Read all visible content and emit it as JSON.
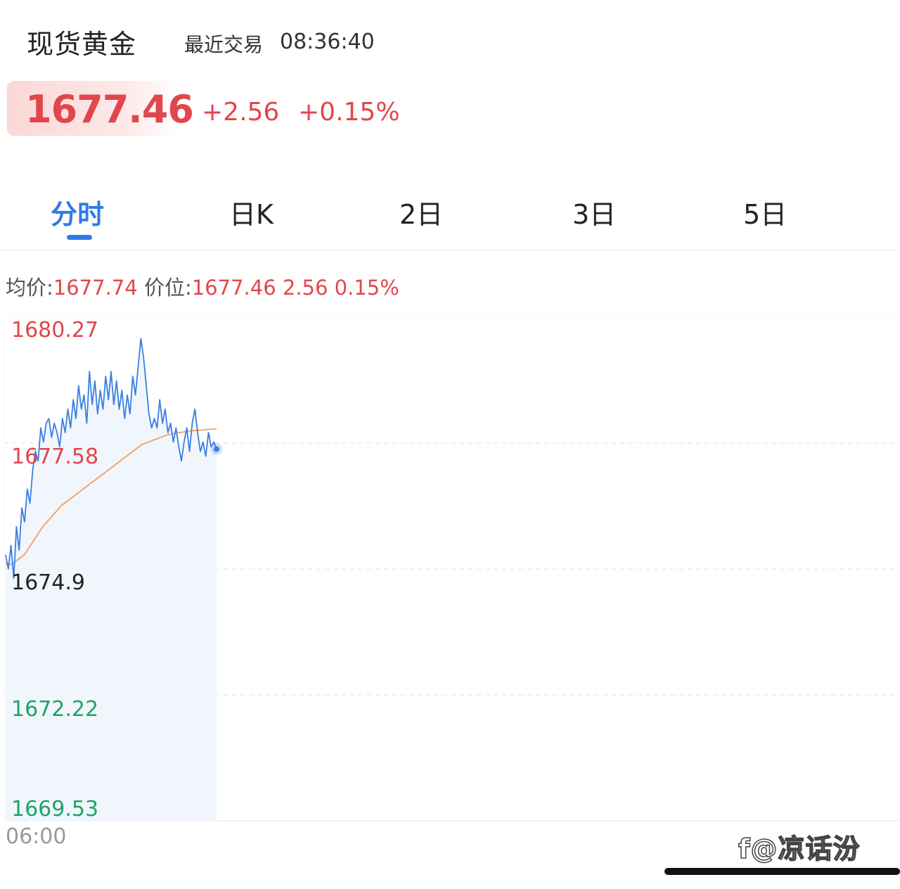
{
  "header": {
    "title": "现货黄金",
    "trade_label": "最近交易",
    "trade_time": "08:36:40"
  },
  "quote": {
    "price": "1677.46",
    "change": "+2.56",
    "change_pct": "+0.15%"
  },
  "tabs": [
    {
      "label": "分时",
      "active": true
    },
    {
      "label": "日K",
      "active": false
    },
    {
      "label": "2日",
      "active": false
    },
    {
      "label": "3日",
      "active": false
    },
    {
      "label": "5日",
      "active": false
    }
  ],
  "summary": {
    "avg_label": "均价:",
    "avg_value": "1677.74",
    "price_label": "价位:",
    "price_value": "1677.46",
    "change": "2.56",
    "change_pct": "0.15%"
  },
  "watermark": "f@凉话汾",
  "colors": {
    "up": "#e0474c",
    "down": "#1fa463",
    "accent": "#2f7be6",
    "price_line": "#3a7fe0",
    "avg_line": "#f0a060"
  },
  "chart_data": {
    "type": "line",
    "x_start": "06:00",
    "ylim": [
      1669.53,
      1680.27
    ],
    "y_ticks": [
      "1680.27",
      "1677.58",
      "1674.9",
      "1672.22",
      "1669.53"
    ],
    "series": [
      {
        "values": [
          1675.2,
          1674.9,
          1675.4,
          1674.7,
          1675.8,
          1675.3,
          1676.2,
          1675.9,
          1676.6,
          1676.3,
          1677.0,
          1677.4,
          1677.2,
          1677.9,
          1677.6,
          1678.0,
          1678.1,
          1677.7,
          1678.0,
          1677.8,
          1677.5,
          1678.1,
          1677.8,
          1678.3,
          1677.9,
          1678.5,
          1678.1,
          1678.8,
          1678.3,
          1678.6,
          1678.0,
          1679.1,
          1678.4,
          1678.9,
          1678.2,
          1678.7,
          1678.3,
          1679.0,
          1678.5,
          1679.1,
          1678.4,
          1678.9,
          1678.3,
          1678.7,
          1678.1,
          1678.6,
          1678.2,
          1679.0,
          1678.6,
          1679.2,
          1679.8,
          1679.4,
          1678.8,
          1678.2,
          1677.9,
          1678.1,
          1677.9,
          1678.5,
          1678.0,
          1678.3,
          1677.8,
          1678.0,
          1677.6,
          1677.9,
          1677.5,
          1677.2,
          1677.6,
          1677.9,
          1677.4,
          1678.0,
          1678.3,
          1677.8,
          1677.4,
          1677.6,
          1677.3,
          1677.8,
          1677.5,
          1677.6,
          1677.45
        ],
        "color": "#3a7fe0"
      },
      {
        "values": [
          1675.0,
          1675.0,
          1675.1,
          1675.2,
          1675.4,
          1675.6,
          1675.8,
          1675.95,
          1676.1,
          1676.25,
          1676.35,
          1676.45,
          1676.55,
          1676.65,
          1676.75,
          1676.85,
          1676.95,
          1677.05,
          1677.15,
          1677.25,
          1677.35,
          1677.45,
          1677.55,
          1677.6,
          1677.65,
          1677.7,
          1677.75,
          1677.78,
          1677.8,
          1677.82,
          1677.84,
          1677.85,
          1677.86,
          1677.87,
          1677.88
        ],
        "color": "#f0a060"
      }
    ]
  }
}
